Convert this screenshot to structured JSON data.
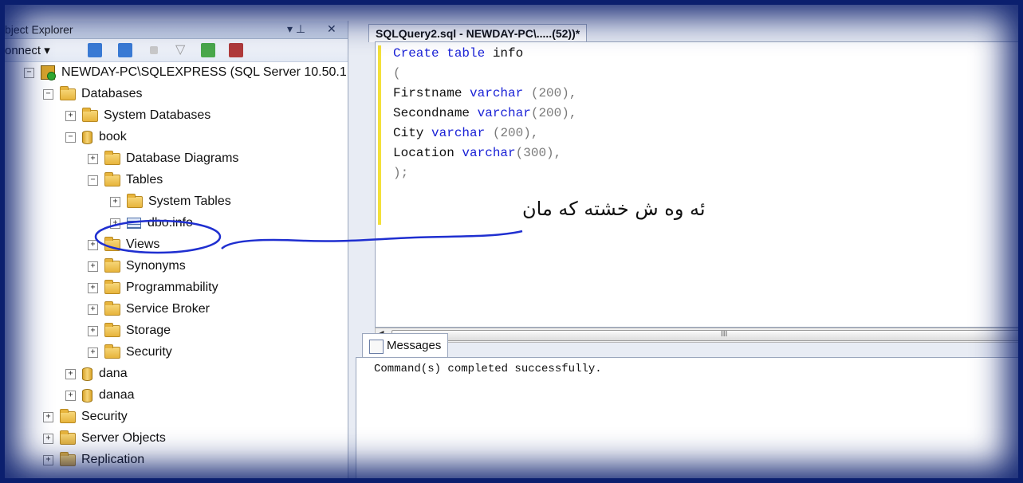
{
  "object_explorer": {
    "title": "bject Explorer",
    "pin": "▾ ⊥",
    "close": "✕",
    "connect_label": "onnect ▾",
    "tree": [
      {
        "label": "NEWDAY-PC\\SQLEXPRESS (SQL Server 10.50.1",
        "icon": "server-icon",
        "exp": "−"
      },
      {
        "label": "Databases",
        "icon": "folder-icon",
        "exp": "−"
      },
      {
        "label": "System Databases",
        "icon": "folder-icon",
        "exp": "+"
      },
      {
        "label": "book",
        "icon": "database-icon",
        "exp": "−"
      },
      {
        "label": "Database Diagrams",
        "icon": "folder-icon",
        "exp": "+"
      },
      {
        "label": "Tables",
        "icon": "folder-icon",
        "exp": "−"
      },
      {
        "label": "System Tables",
        "icon": "folder-icon",
        "exp": "+"
      },
      {
        "label": "dbo.info",
        "icon": "table-icon",
        "exp": "+"
      },
      {
        "label": "Views",
        "icon": "folder-icon",
        "exp": "+"
      },
      {
        "label": "Synonyms",
        "icon": "folder-icon",
        "exp": "+"
      },
      {
        "label": "Programmability",
        "icon": "folder-icon",
        "exp": "+"
      },
      {
        "label": "Service Broker",
        "icon": "folder-icon",
        "exp": "+"
      },
      {
        "label": "Storage",
        "icon": "folder-icon",
        "exp": "+"
      },
      {
        "label": "Security",
        "icon": "folder-icon",
        "exp": "+"
      },
      {
        "label": "dana",
        "icon": "database-icon",
        "exp": "+"
      },
      {
        "label": "danaa",
        "icon": "database-icon",
        "exp": "+"
      },
      {
        "label": "Security",
        "icon": "folder-icon",
        "exp": "+"
      },
      {
        "label": "Server Objects",
        "icon": "folder-icon",
        "exp": "+"
      },
      {
        "label": "Replication",
        "icon": "folder-icon",
        "exp": "+"
      }
    ]
  },
  "editor": {
    "tab_title": "SQLQuery2.sql - NEWDAY-PC\\.....(52))*",
    "lines": [
      {
        "kw1": "Create table",
        "rest": " info"
      },
      {
        "gray": "("
      },
      {
        "plain": "Firstname ",
        "kw": "varchar",
        "gray": " (200),"
      },
      {
        "plain": "Secondname  ",
        "kw": "varchar",
        "gray": "(200),"
      },
      {
        "plain": "City ",
        "kw": "varchar",
        "gray": " (200),"
      },
      {
        "plain": "Location ",
        "kw": "varchar",
        "gray": "(300),"
      },
      {
        "gray": ");"
      }
    ]
  },
  "messages": {
    "tab_label": "Messages",
    "text": "Command(s) completed successfully."
  },
  "annotation": {
    "text": "ئه وه ش خشته كه مان"
  },
  "colors": {
    "frame": "#0b1f6e",
    "keyword": "#1a22d6",
    "ink": "#1f2fd0"
  }
}
